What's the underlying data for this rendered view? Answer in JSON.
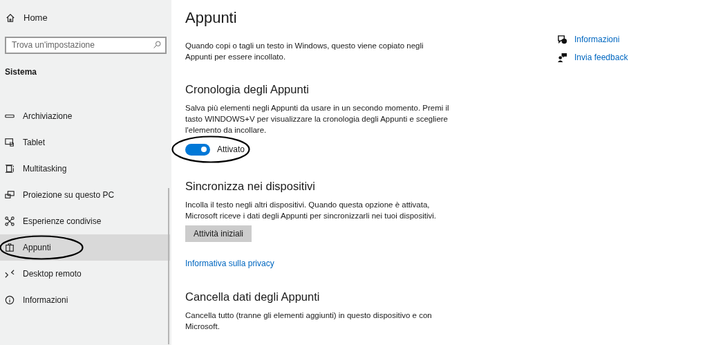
{
  "sidebar": {
    "home": "Home",
    "search": {
      "placeholder": "Trova un'impostazione"
    },
    "section": "Sistema",
    "items": [
      {
        "label": "Archiviazione",
        "selected": false,
        "circled": false
      },
      {
        "label": "Tablet",
        "selected": false,
        "circled": false
      },
      {
        "label": "Multitasking",
        "selected": false,
        "circled": false
      },
      {
        "label": "Proiezione su questo PC",
        "selected": false,
        "circled": false
      },
      {
        "label": "Esperienze condivise",
        "selected": false,
        "circled": false
      },
      {
        "label": "Appunti",
        "selected": true,
        "circled": true
      },
      {
        "label": "Desktop remoto",
        "selected": false,
        "circled": false
      },
      {
        "label": "Informazioni",
        "selected": false,
        "circled": false
      }
    ]
  },
  "page": {
    "title": "Appunti",
    "intro": "Quando copi o tagli un testo in Windows, questo viene copiato negli Appunti per essere incollato.",
    "sections": [
      {
        "heading": "Cronologia degli Appunti",
        "text": "Salva più elementi negli Appunti da usare in un secondo momento. Premi il tasto WINDOWS+V per visualizzare la cronologia degli Appunti e scegliere l'elemento da incollare.",
        "toggle": {
          "on": true,
          "label": "Attivato",
          "circled": true
        }
      },
      {
        "heading": "Sincronizza nei dispositivi",
        "text": "Incolla il testo negli altri dispositivi. Quando questa opzione è attivata, Microsoft riceve i dati degli Appunti per sincronizzarli nei tuoi dispositivi.",
        "button": "Attività iniziali",
        "link": "Informativa sulla privacy"
      },
      {
        "heading": "Cancella dati degli Appunti",
        "text": "Cancella tutto (tranne gli elementi aggiunti) in questo dispositivo e con Microsoft."
      }
    ]
  },
  "help_links": [
    {
      "label": "Informazioni"
    },
    {
      "label": "Invia feedback"
    }
  ]
}
